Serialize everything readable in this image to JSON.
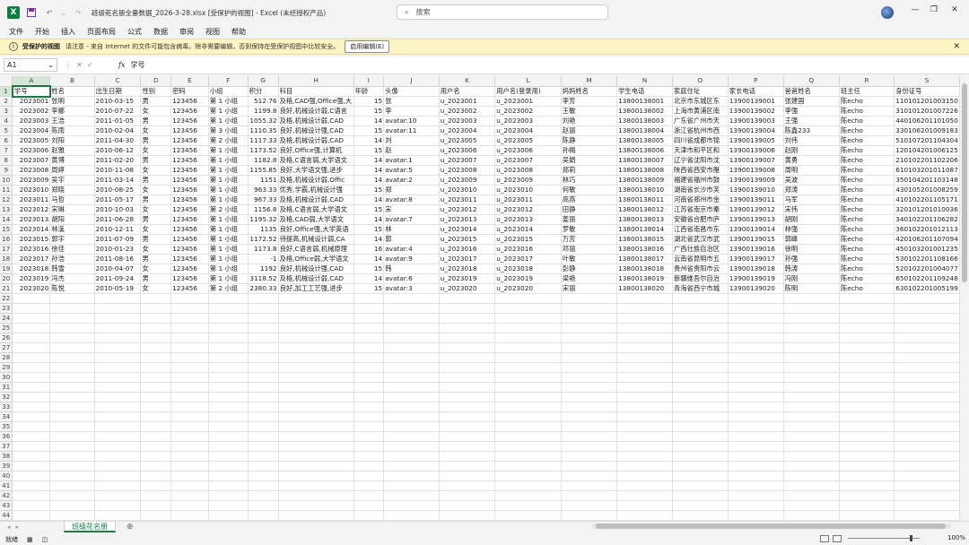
{
  "titlebar": {
    "filename": "班级花名册全量数据_2026-3-28.xlsx  [受保护的视图]  -  Excel (未经授权产品)",
    "search_placeholder": "搜索"
  },
  "menu": [
    "文件",
    "开始",
    "插入",
    "页面布局",
    "公式",
    "数据",
    "审阅",
    "视图",
    "帮助"
  ],
  "protected": {
    "title": "受保护的视图",
    "message": "请注意 - 来自 Internet 的文件可能包含病毒。除非需要编辑，否则保持在受保护视图中比较安全。",
    "button": "启用编辑(E)"
  },
  "formula_bar": {
    "cell": "A1",
    "content": "学号"
  },
  "columns": [
    "A",
    "B",
    "C",
    "D",
    "E",
    "F",
    "G",
    "H",
    "I",
    "J",
    "K",
    "L",
    "M",
    "N",
    "O",
    "P",
    "Q",
    "R",
    "S"
  ],
  "headers": [
    "学号",
    "姓名",
    "出生日期",
    "性别",
    "密码",
    "小组",
    "积分",
    "科目",
    "年龄",
    "头像",
    "用户名",
    "用户名(登录用)",
    "妈妈姓名",
    "学生电话",
    "家庭住址",
    "家长电话",
    "爸爸姓名",
    "班主任",
    "身份证号"
  ],
  "rows": [
    [
      "2023001",
      "张明",
      "2010-03-15",
      "男",
      "123456",
      "第 1 小组",
      "512.76",
      "及格,CAD强,Office强,大",
      "15",
      "张",
      "u_2023001",
      "u_2023001",
      "李芳",
      "13800138001",
      "北京市东城区东",
      "13900139001",
      "张建国",
      "陈echo",
      "110101201003150"
    ],
    [
      "2023002",
      "李娜",
      "2010-07-22",
      "女",
      "123456",
      "第 1 小组",
      "1199.8",
      "良好,机械设计弱,C语言",
      "15",
      "李",
      "u_2023002",
      "u_2023002",
      "王敏",
      "13800138002",
      "上海市黄浦区南",
      "13900139002",
      "李强",
      "陈echo",
      "310101201007226"
    ],
    [
      "2023003",
      "王浩",
      "2011-01-05",
      "男",
      "123456",
      "第 1 小组",
      "1055.32",
      "及格,机械设计弱,CAD",
      "14",
      "avatar:10",
      "u_2023003",
      "u_2023003",
      "刘艳",
      "13800138003",
      "广东省广州市天",
      "13900139003",
      "王强",
      "陈echo",
      "440106201101050"
    ],
    [
      "2023004",
      "陈雨",
      "2010-02-04",
      "女",
      "123456",
      "第 3 小组",
      "1110.35",
      "良好,机械设计强,CAD",
      "15",
      "avatar:11",
      "u_2023004",
      "u_2023004",
      "赵丽",
      "13800138004",
      "浙江省杭州市西",
      "13900139004",
      "陈鑫233",
      "陈echo",
      "330106201009183"
    ],
    [
      "2023005",
      "刘阳",
      "2011-04-30",
      "男",
      "123456",
      "第 2 小组",
      "1117.33",
      "及格,机械设计弱,CAD",
      "14",
      "刘",
      "u_2023005",
      "u_2023005",
      "陈静",
      "13800138005",
      "四川省成都市锦",
      "13900139005",
      "刘伟",
      "陈echo",
      "510107201104304"
    ],
    [
      "2023006",
      "赵雅",
      "2010-06-12",
      "女",
      "123456",
      "第 1 小组",
      "1173.52",
      "良好,Office强,计算机",
      "15",
      "赵",
      "u_2023006",
      "u_2023006",
      "孙梅",
      "13800138006",
      "天津市和平区和",
      "13900139006",
      "赵刚",
      "陈echo",
      "120104201006125"
    ],
    [
      "2023007",
      "黄博",
      "2011-02-20",
      "男",
      "123456",
      "第 1 小组",
      "1182.8",
      "及格,C语言弱,大学语文",
      "14",
      "avatar:1",
      "u_2023007",
      "u_2023007",
      "吴娟",
      "13800138007",
      "辽宁省沈阳市沈",
      "13900139007",
      "黄勇",
      "陈echo",
      "210102201102206"
    ],
    [
      "2023008",
      "周婷",
      "2010-11-08",
      "女",
      "123456",
      "第 1 小组",
      "1155.85",
      "良好,大学语文强,进步",
      "14",
      "avatar:5",
      "u_2023008",
      "u_2023008",
      "郑莉",
      "13800138008",
      "陕西省西安市雁",
      "13900139008",
      "周明",
      "陈echo",
      "610103201011087"
    ],
    [
      "2023009",
      "吴宇",
      "2011-03-14",
      "男",
      "123456",
      "第 1 小组",
      "1151",
      "及格,机械设计弱,Offic",
      "14",
      "avatar:2",
      "u_2023009",
      "u_2023009",
      "林巧",
      "13800138009",
      "福建省福州市鼓",
      "13900139009",
      "吴波",
      "陈echo",
      "350104201103148"
    ],
    [
      "2023010",
      "郑晓",
      "2010-08-25",
      "女",
      "123456",
      "第 1 小组",
      "963.33",
      "优秀,学霸,机械设计强",
      "15",
      "郑",
      "u_2023010",
      "u_2023010",
      "何敏",
      "13800138010",
      "湖南省长沙市芙",
      "13900139010",
      "郑涛",
      "陈echo",
      "430105201008259"
    ],
    [
      "2023011",
      "马哲",
      "2011-05-17",
      "男",
      "123456",
      "第 1 小组",
      "967.33",
      "及格,机械设计弱,CAD",
      "14",
      "avatar:8",
      "u_2023011",
      "u_2023011",
      "高燕",
      "13800138011",
      "河南省郑州市金",
      "13900139011",
      "马军",
      "陈echo",
      "410102201105171"
    ],
    [
      "2023012",
      "宋琳",
      "2010-10-03",
      "女",
      "123456",
      "第 2 小组",
      "1156.8",
      "及格,C语言弱,大学语文",
      "15",
      "宋",
      "u_2023012",
      "u_2023012",
      "田静",
      "13800138012",
      "江苏省南京市秦",
      "13900139012",
      "宋伟",
      "陈echo",
      "320101201010036"
    ],
    [
      "2023013",
      "胡阳",
      "2011-06-28",
      "男",
      "123456",
      "第 1 小组",
      "1195.32",
      "及格,CAD弱,大学语文",
      "14",
      "avatar:7",
      "u_2023013",
      "u_2023013",
      "姜丽",
      "13800138013",
      "安徽省合肥市庐",
      "13900139013",
      "胡刚",
      "陈echo",
      "340102201106282"
    ],
    [
      "2023014",
      "林溪",
      "2010-12-11",
      "女",
      "123456",
      "第 1 小组",
      "1135",
      "良好,Office强,大学英语",
      "15",
      "林",
      "u_2023014",
      "u_2023014",
      "罗敏",
      "13800138014",
      "江西省南昌市东",
      "13900139014",
      "林强",
      "陈echo",
      "360102201012113"
    ],
    [
      "2023015",
      "郭宇",
      "2011-07-09",
      "男",
      "123456",
      "第 1 小组",
      "1172.52",
      "待提高,机械设计弱,CA",
      "14",
      "郭",
      "u_2023015",
      "u_2023015",
      "万芳",
      "13800138015",
      "湖北省武汉市武",
      "13900139015",
      "郭峰",
      "陈echo",
      "420106201107094"
    ],
    [
      "2023016",
      "徐佳",
      "2010-01-23",
      "女",
      "123456",
      "第 1 小组",
      "1173.8",
      "良好,C语言弱,机械原理",
      "16",
      "avatar:4",
      "u_2023016",
      "u_2023016",
      "邓丽",
      "13800138016",
      "广西壮族自治区",
      "13900139016",
      "徐明",
      "陈echo",
      "450103201001235"
    ],
    [
      "2023017",
      "孙浩",
      "2011-08-16",
      "男",
      "123456",
      "第 1 小组",
      "-1",
      "及格,Office弱,大学语文",
      "14",
      "avatar:9",
      "u_2023017",
      "u_2023017",
      "叶敏",
      "13800138017",
      "云南省昆明市五",
      "13900139017",
      "孙强",
      "陈echo",
      "530102201108166"
    ],
    [
      "2023018",
      "韩雪",
      "2010-04-07",
      "女",
      "123456",
      "第 1 小组",
      "1192",
      "良好,机械设计强,CAD",
      "15",
      "韩",
      "u_2023018",
      "u_2023018",
      "彭静",
      "13800138018",
      "贵州省贵阳市云",
      "13900139018",
      "韩涛",
      "陈echo",
      "520102201004077"
    ],
    [
      "2023019",
      "冯杰",
      "2011-09-24",
      "男",
      "123456",
      "第 1 小组",
      "3118.52",
      "及格,机械设计弱,CAD",
      "14",
      "avatar:6",
      "u_2023019",
      "u_2023019",
      "梁艳",
      "13800138019",
      "新疆维吾尔自治",
      "13900139019",
      "冯刚",
      "陈echo",
      "650102201109248"
    ],
    [
      "2023020",
      "陈悦",
      "2010-05-19",
      "女",
      "123456",
      "第 2 小组",
      "2380.33",
      "良好,加工工艺强,进步",
      "15",
      "avatar:3",
      "u_2023020",
      "u_2023020",
      "宋丽",
      "13800138020",
      "青海省西宁市城",
      "13900139020",
      "陈明",
      "陈echo",
      "630102201005199"
    ]
  ],
  "sheet_tab": "班级花名册",
  "status": {
    "ready": "就绪",
    "zoom": "100%"
  }
}
